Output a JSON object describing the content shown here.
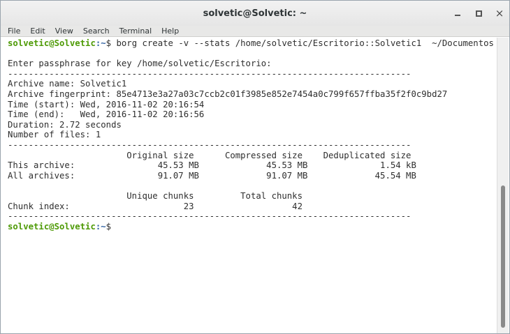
{
  "window": {
    "title": "solvetic@Solvetic: ~",
    "controls": {
      "minimize": "minimize",
      "maximize": "maximize",
      "close": "×"
    }
  },
  "menu": {
    "items": [
      "File",
      "Edit",
      "View",
      "Search",
      "Terminal",
      "Help"
    ]
  },
  "terminal": {
    "prompt_user": "solvetic@Solvetic",
    "prompt_path": ":~",
    "command": "$ borg create -v --stats /home/solvetic/Escritorio::Solvetic1  ~/Documentos",
    "lines": [
      "",
      "Enter passphrase for key /home/solvetic/Escritorio:",
      "------------------------------------------------------------------------------",
      "Archive name: Solvetic1",
      "Archive fingerprint: 85e4713e3a27a03c7ccb2c01f3985e852e7454a0c799f657ffba35f2f0c9bd27",
      "Time (start): Wed, 2016-11-02 20:16:54",
      "Time (end):   Wed, 2016-11-02 20:16:56",
      "Duration: 2.72 seconds",
      "Number of files: 1",
      "------------------------------------------------------------------------------",
      "                       Original size      Compressed size    Deduplicated size",
      "This archive:                45.53 MB             45.53 MB              1.54 kB",
      "All archives:                91.07 MB             91.07 MB             45.54 MB",
      "",
      "                       Unique chunks         Total chunks",
      "Chunk index:                      23                   42",
      "------------------------------------------------------------------------------"
    ],
    "final_prompt_symbol": "$"
  }
}
